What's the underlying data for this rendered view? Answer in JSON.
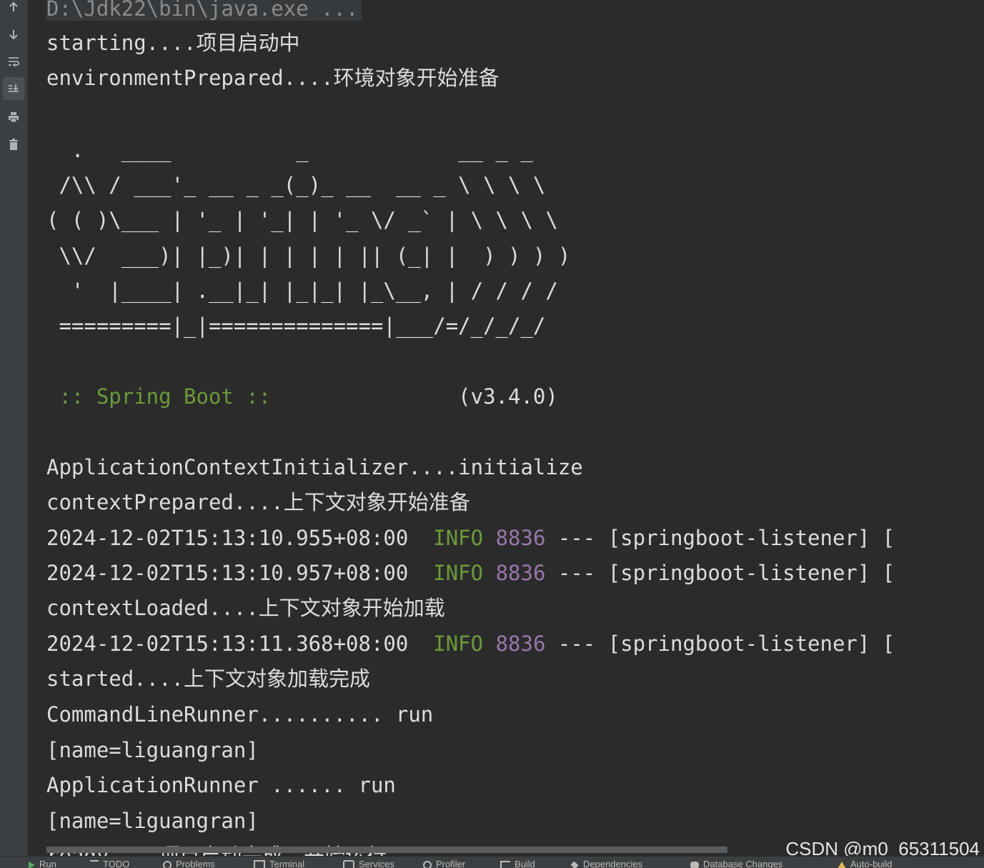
{
  "gutter": {
    "icons": [
      "arrow-up-icon",
      "arrow-down-icon",
      "soft-wrap-icon",
      "scroll-to-end-icon",
      "print-icon",
      "trash-icon"
    ]
  },
  "console": {
    "command": "D:\\Jdk22\\bin\\java.exe ...",
    "lines": {
      "l1": "starting....项目启动中",
      "l2": "environmentPrepared....环境对象开始准备",
      "banner1": "  .   ____          _            __ _ _",
      "banner2": " /\\\\ / ___'_ __ _ _(_)_ __  __ _ \\ \\ \\ \\",
      "banner3": "( ( )\\___ | '_ | '_| | '_ \\/ _` | \\ \\ \\ \\",
      "banner4": " \\\\/  ___)| |_)| | | | | || (_| |  ) ) ) )",
      "banner5": "  '  |____| .__|_| |_|_| |_\\__, | / / / /",
      "banner6": " =========|_|==============|___/=/_/_/_/",
      "spring_label": " :: Spring Boot :: ",
      "spring_version": "              (v3.4.0)",
      "l3": "ApplicationContextInitializer....initialize",
      "l4": "contextPrepared....上下文对象开始准备",
      "log1_time": "2024-12-02T15:13:10.955+08:00",
      "log1_rest": " --- [springboot-listener] [",
      "log2_time": "2024-12-02T15:13:10.957+08:00",
      "log2_rest": " --- [springboot-listener] [",
      "l5": "contextLoaded....上下文对象开始加载",
      "log3_time": "2024-12-02T15:13:11.368+08:00",
      "log3_rest": " --- [springboot-listener] [",
      "l6": "started....上下文对象加载完成",
      "l7": "CommandLineRunner.......... run",
      "l8": "[name=liguangran]",
      "l9": "ApplicationRunner ...... run",
      "l10": "[name=liguangran]",
      "l11": "ready....项目启动完成，开始运行"
    },
    "log_level": "INFO",
    "pid": "8836"
  },
  "watermark": "CSDN @m0_65311504",
  "statusbar": {
    "items": [
      "Run",
      "TODO",
      "Problems",
      "Terminal",
      "Services",
      "Profiler",
      "Build",
      "Dependencies",
      "Database Changes",
      "Auto-build"
    ]
  },
  "colors": {
    "background": "#2b2b2b",
    "text": "#dcdcdc",
    "spring_green": "#6a9a3a",
    "pid_purple": "#9876aa"
  }
}
